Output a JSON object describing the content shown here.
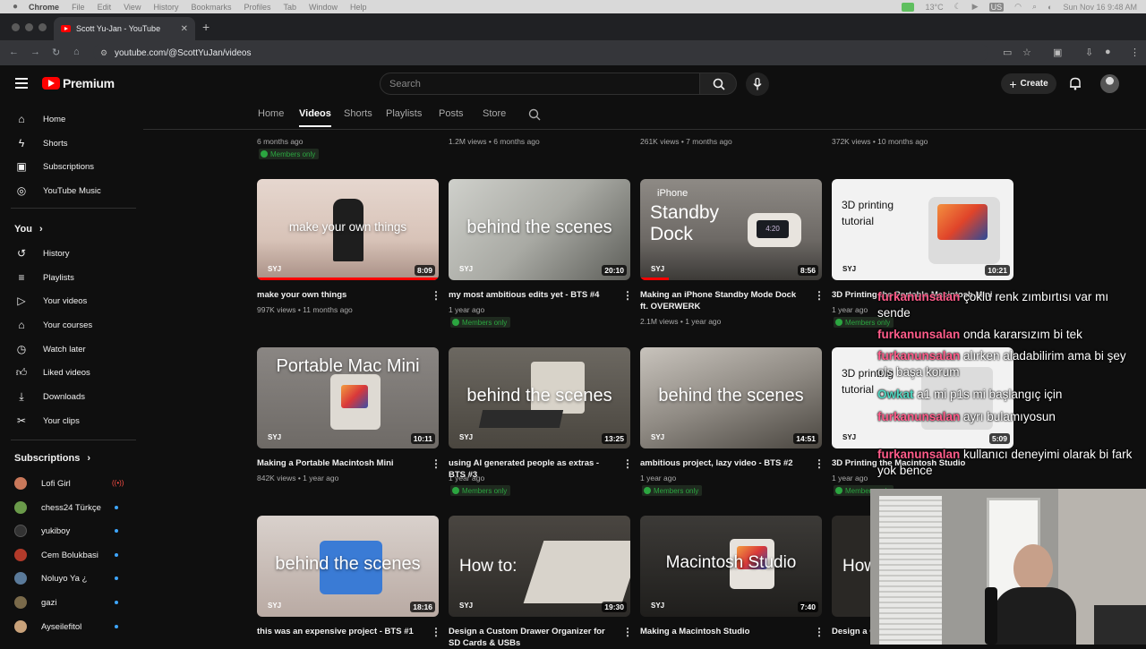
{
  "menubar": {
    "app": "Chrome",
    "items": [
      "File",
      "Edit",
      "View",
      "History",
      "Bookmarks",
      "Profiles",
      "Tab",
      "Window",
      "Help"
    ],
    "weather": "13°C",
    "lang": "US",
    "datetime": "Sun Nov 16  9:48 AM"
  },
  "browser": {
    "tab_title": "Scott Yu-Jan - YouTube",
    "url": "youtube.com/@ScottYuJan/videos"
  },
  "header": {
    "logo": "Premium",
    "search_placeholder": "Search",
    "create_label": "Create"
  },
  "channel_tabs": [
    "Home",
    "Videos",
    "Shorts",
    "Playlists",
    "Posts",
    "Store"
  ],
  "sidebar": {
    "main": [
      {
        "label": "Home",
        "icon": "home-icon"
      },
      {
        "label": "Shorts",
        "icon": "shorts-icon"
      },
      {
        "label": "Subscriptions",
        "icon": "subscriptions-icon"
      },
      {
        "label": "YouTube Music",
        "icon": "music-icon"
      }
    ],
    "you_header": "You",
    "you": [
      {
        "label": "History",
        "icon": "history-icon"
      },
      {
        "label": "Playlists",
        "icon": "playlists-icon"
      },
      {
        "label": "Your videos",
        "icon": "your-videos-icon"
      },
      {
        "label": "Your courses",
        "icon": "courses-icon"
      },
      {
        "label": "Watch later",
        "icon": "watch-later-icon"
      },
      {
        "label": "Liked videos",
        "icon": "liked-icon"
      },
      {
        "label": "Downloads",
        "icon": "downloads-icon"
      },
      {
        "label": "Your clips",
        "icon": "clips-icon"
      }
    ],
    "subs_header": "Subscriptions",
    "subs": [
      {
        "label": "Lofi Girl",
        "color": "#c9785a",
        "live": true
      },
      {
        "label": "chess24 Türkçe",
        "color": "#6a9a4a",
        "live": false
      },
      {
        "label": "yukiboy",
        "color": "#333333",
        "live": false
      },
      {
        "label": "Cem Bolukbasi",
        "color": "#b23a2a",
        "live": false
      },
      {
        "label": "Noluyo Ya ¿",
        "color": "#5a7a9a",
        "live": false
      },
      {
        "label": "gazi",
        "color": "#7a6a4a",
        "live": false
      },
      {
        "label": "Ayseilefitol",
        "color": "#c9a27a",
        "live": false
      }
    ]
  },
  "top_row_meta": [
    "6 months ago",
    "1.2M views • 6 months ago",
    "261K views • 7 months ago",
    "372K views • 10 months ago"
  ],
  "members_only": "Members only",
  "videos": [
    {
      "title": "make your own things",
      "meta": "997K views • 11 months ago",
      "duration": "8:09",
      "overlay": "make your own things",
      "members": false
    },
    {
      "title": "my most ambitious edits yet - BTS #4",
      "meta": "1 year ago",
      "duration": "20:10",
      "overlay": "behind the scenes",
      "members": true
    },
    {
      "title": "Making an iPhone Standby Mode Dock ft. OVERWERK",
      "meta": "2.1M views • 1 year ago",
      "duration": "8:56",
      "overlay_top": "iPhone",
      "overlay": "Standby Dock",
      "members": false
    },
    {
      "title": "3D Printing the Portable Macintosh Mini",
      "meta": "1 year ago",
      "duration": "10:21",
      "overlay": "3D printing tutorial",
      "members": true
    },
    {
      "title": "Making a Portable Macintosh Mini",
      "meta": "842K views • 1 year ago",
      "duration": "10:11",
      "overlay": "Portable Mac Mini",
      "members": false
    },
    {
      "title": "using AI generated people as extras - BTS #3",
      "meta": "1 year ago",
      "duration": "13:25",
      "overlay": "behind the scenes",
      "members": true
    },
    {
      "title": "ambitious project, lazy video - BTS #2",
      "meta": "1 year ago",
      "duration": "14:51",
      "overlay": "behind the scenes",
      "members": true
    },
    {
      "title": "3D Printing the Macintosh Studio",
      "meta": "1 year ago",
      "duration": "5:09",
      "overlay": "3D printing tutorial",
      "members": true
    },
    {
      "title": "this was an expensive project - BTS #1",
      "meta": "",
      "duration": "18:16",
      "overlay": "behind the scenes",
      "members": false
    },
    {
      "title": "Design a Custom Drawer Organizer for SD Cards & USBs",
      "meta": "",
      "duration": "19:30",
      "overlay": "How to:",
      "members": false
    },
    {
      "title": "Making a Macintosh Studio",
      "meta": "",
      "duration": "7:40",
      "overlay": "Macintosh Studio",
      "members": false
    },
    {
      "title": "Design a C",
      "meta": "",
      "duration": "",
      "overlay": "How",
      "members": false
    }
  ],
  "brand_mark": "SYJ",
  "chat": [
    {
      "user": "furkanunsalan",
      "msg": "çoklu renk zımbırtısı var mı sende"
    },
    {
      "user": "furkanunsalan",
      "msg": "onda kararsızım bi tek"
    },
    {
      "user": "furkanunsalan",
      "msg": "alırken aladabilirim ama bi şey ols başa korum"
    },
    {
      "user": "Owkat",
      "msg": "a1 mi p1s mi başlangıç için"
    },
    {
      "user": "furkanunsalan",
      "msg": "ayrı bulamıyosun"
    },
    {
      "user": "furkanunsalan",
      "msg": "kullanıcı deneyimi olarak bi fark yok bence"
    }
  ]
}
